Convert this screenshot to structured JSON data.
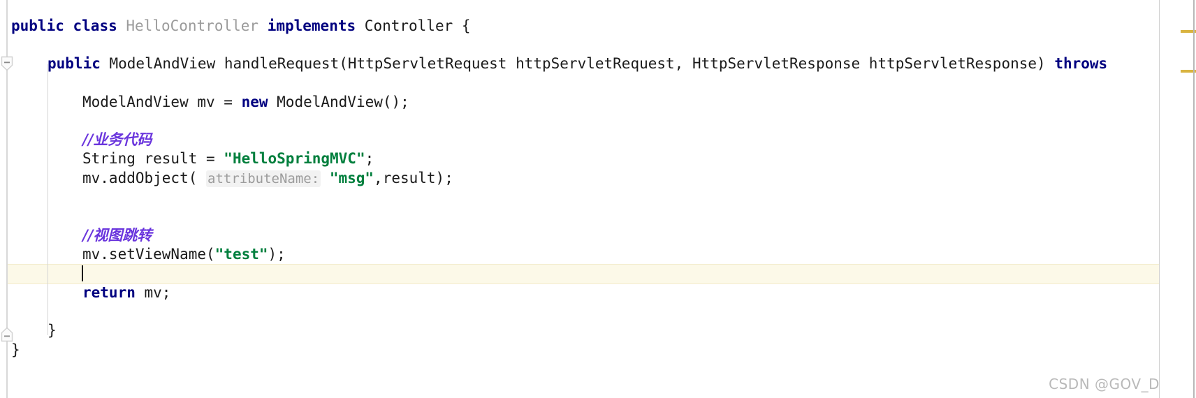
{
  "editor": {
    "language": "java",
    "theme": "intellij-light",
    "colors": {
      "background": "#ffffff",
      "keyword": "#000080",
      "string": "#007f3d",
      "comment": "#6a35dd",
      "class_name": "#9b9b9b",
      "plain_text": "#1b1b1b",
      "inlay_hint_text": "#9c9c9c",
      "inlay_hint_background": "#f2f2f2",
      "caret_line_highlight": "#fcf9e8",
      "gutter_divider": "#d8d8d8",
      "indent_guide": "#d4d4d4",
      "marker_stripe": "#d9b441",
      "watermark": "#b9b9b9"
    },
    "lines": [
      {
        "id": "line-class-decl",
        "indent": 0,
        "tokens": [
          {
            "type": "keyword",
            "text": "public"
          },
          {
            "type": "plain",
            "text": " "
          },
          {
            "type": "keyword",
            "text": "class"
          },
          {
            "type": "plain",
            "text": " "
          },
          {
            "type": "class",
            "text": "HelloController"
          },
          {
            "type": "plain",
            "text": " "
          },
          {
            "type": "keyword",
            "text": "implements"
          },
          {
            "type": "plain",
            "text": " "
          },
          {
            "type": "plain",
            "text": "Controller {"
          }
        ]
      },
      {
        "id": "line-method-signature",
        "indent": 1,
        "tokens": [
          {
            "type": "keyword",
            "text": "public"
          },
          {
            "type": "plain",
            "text": " ModelAndView handleRequest(HttpServletRequest httpServletRequest, HttpServletResponse httpServletResponse) "
          },
          {
            "type": "keyword",
            "text": "throws"
          }
        ]
      },
      {
        "id": "line-mv-init",
        "indent": 2,
        "tokens": [
          {
            "type": "plain",
            "text": "ModelAndView mv = "
          },
          {
            "type": "keyword",
            "text": "new"
          },
          {
            "type": "plain",
            "text": " ModelAndView();"
          }
        ]
      },
      {
        "id": "line-comment-business",
        "indent": 2,
        "tokens": [
          {
            "type": "comment",
            "text": "//业务代码"
          }
        ]
      },
      {
        "id": "line-result-decl",
        "indent": 2,
        "tokens": [
          {
            "type": "plain",
            "text": "String result = "
          },
          {
            "type": "string",
            "text": "\"HelloSpringMVC\""
          },
          {
            "type": "plain",
            "text": ";"
          }
        ]
      },
      {
        "id": "line-add-object",
        "indent": 2,
        "tokens": [
          {
            "type": "plain",
            "text": "mv.addObject( "
          },
          {
            "type": "hint",
            "text": "attributeName:"
          },
          {
            "type": "plain",
            "text": " "
          },
          {
            "type": "string",
            "text": "\"msg\""
          },
          {
            "type": "plain",
            "text": ",result);"
          }
        ]
      },
      {
        "id": "line-comment-view",
        "indent": 2,
        "tokens": [
          {
            "type": "comment",
            "text": "//视图跳转"
          }
        ]
      },
      {
        "id": "line-set-view-name",
        "indent": 2,
        "tokens": [
          {
            "type": "plain",
            "text": "mv.setViewName("
          },
          {
            "type": "string",
            "text": "\"test\""
          },
          {
            "type": "plain",
            "text": ");"
          }
        ]
      },
      {
        "id": "line-return",
        "indent": 2,
        "tokens": [
          {
            "type": "keyword",
            "text": "return"
          },
          {
            "type": "plain",
            "text": " mv;"
          }
        ]
      },
      {
        "id": "line-close-method",
        "indent": 1,
        "tokens": [
          {
            "type": "plain",
            "text": "}"
          }
        ]
      },
      {
        "id": "line-close-class",
        "indent": 0,
        "tokens": [
          {
            "type": "plain",
            "text": "}"
          }
        ]
      }
    ],
    "caret": {
      "line_index": 8,
      "column": 8,
      "visible": true
    },
    "fold_markers": [
      {
        "id": "fold-method-open",
        "glyph": "minus",
        "state": "expanded"
      },
      {
        "id": "fold-method-close",
        "glyph": "minus",
        "state": "expanded"
      }
    ],
    "marker_stripes": [
      {
        "id": "stripe-warning-top"
      },
      {
        "id": "stripe-warning-second"
      }
    ]
  },
  "watermark": {
    "text": "CSDN @GOV_D"
  }
}
